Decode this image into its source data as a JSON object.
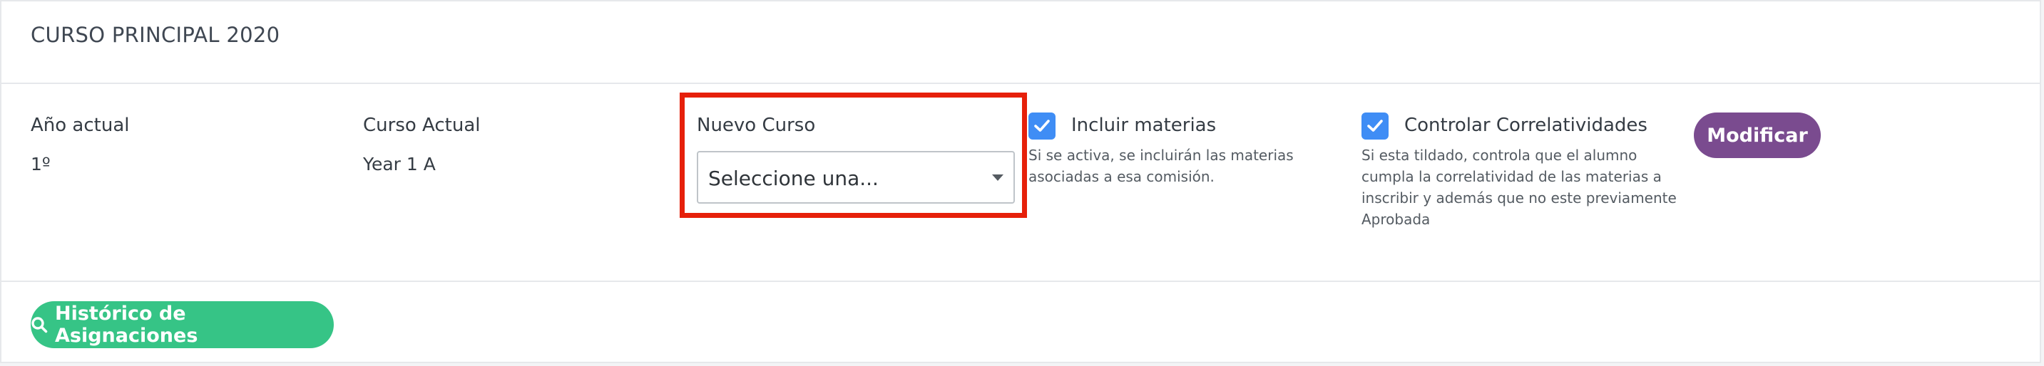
{
  "card": {
    "title": "CURSO PRINCIPAL 2020"
  },
  "fields": {
    "anio_actual": {
      "label": "Año actual",
      "value": "1º"
    },
    "curso_actual": {
      "label": "Curso Actual",
      "value": "Year 1 A"
    },
    "nuevo_curso": {
      "label": "Nuevo Curso",
      "placeholder": "Seleccione una..."
    }
  },
  "options": {
    "incluir_materias": {
      "label": "Incluir materias",
      "checked": true,
      "help_lines": [
        "Si se activa, se incluirán las materias",
        "asociadas a esa comisión."
      ]
    },
    "controlar_correlatividades": {
      "label": "Controlar Correlatividades",
      "checked": true,
      "help_lines": [
        "Si esta tildado, controla que el alumno",
        "cumpla la correlatividad de las materias a",
        "inscribir y además que no este previamente",
        "Aprobada"
      ]
    }
  },
  "buttons": {
    "modificar": "Modificar",
    "historico": "Histórico de Asignaciones"
  },
  "icons": {
    "checkbox": "check-icon",
    "historico": "search-icon",
    "select": "caret-down-icon"
  },
  "colors": {
    "highlight": "#e6200a",
    "checkbox": "#3f8df5",
    "modificar": "#7a4b8f",
    "historico": "#36c486"
  }
}
